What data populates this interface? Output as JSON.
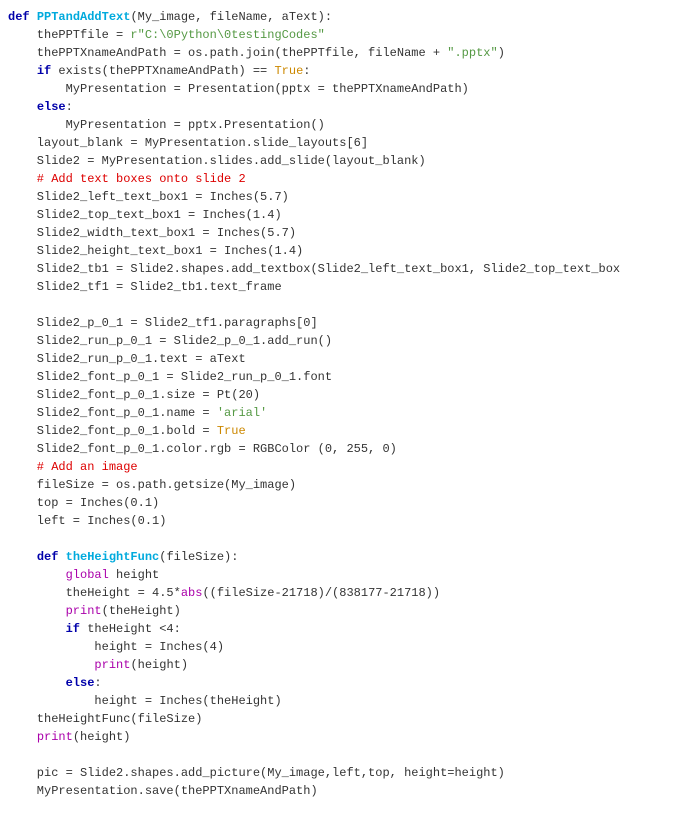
{
  "code": {
    "line": "def ",
    "defName": "PPTandAddText",
    "params": "(My_image, fileName, aText):",
    "l2a": "    thePPTfile = ",
    "l2b": "r\"C:\\0Python\\0testingCodes\"",
    "l3a": "    thePPTXnameAndPath = os.path.join(thePPTfile, fileName + ",
    "l3b": "\".pptx\"",
    "l3c": ")",
    "l4a": "    ",
    "l4if": "if",
    "l4b": " exists(thePPTXnameAndPath) == ",
    "l4true": "True",
    "l4c": ":",
    "l5": "        MyPresentation = Presentation(pptx = thePPTXnameAndPath)",
    "l6a": "    ",
    "l6else": "else",
    "l6b": ":",
    "l7": "        MyPresentation = pptx.Presentation()",
    "l8": "    layout_blank = MyPresentation.slide_layouts[6]",
    "l9": "    Slide2 = MyPresentation.slides.add_slide(layout_blank)",
    "l10": "    # Add text boxes onto slide 2",
    "l11": "    Slide2_left_text_box1 = Inches(5.7)",
    "l12": "    Slide2_top_text_box1 = Inches(1.4)",
    "l13": "    Slide2_width_text_box1 = Inches(5.7)",
    "l14": "    Slide2_height_text_box1 = Inches(1.4)",
    "l15": "    Slide2_tb1 = Slide2.shapes.add_textbox(Slide2_left_text_box1, Slide2_top_text_box",
    "l16": "    Slide2_tf1 = Slide2_tb1.text_frame",
    "l17": "",
    "l18": "    Slide2_p_0_1 = Slide2_tf1.paragraphs[0]",
    "l19": "    Slide2_run_p_0_1 = Slide2_p_0_1.add_run()",
    "l20": "    Slide2_run_p_0_1.text = aText",
    "l21": "    Slide2_font_p_0_1 = Slide2_run_p_0_1.font",
    "l22": "    Slide2_font_p_0_1.size = Pt(20)",
    "l23a": "    Slide2_font_p_0_1.name = ",
    "l23b": "'arial'",
    "l24a": "    Slide2_font_p_0_1.bold = ",
    "l24true": "True",
    "l25": "    Slide2_font_p_0_1.color.rgb = RGBColor (0, 255, 0)",
    "l26": "    # Add an image",
    "l27": "    fileSize = os.path.getsize(My_image)",
    "l28": "    top = Inches(0.1)",
    "l29": "    left = Inches(0.1)",
    "l30": "",
    "l31a": "    ",
    "l31def": "def",
    "l31b": " ",
    "l31fn": "theHeightFunc",
    "l31c": "(fileSize):",
    "l32a": "        ",
    "l32global": "global",
    "l32b": " height",
    "l33a": "        theHeight = 4.5*",
    "l33abs": "abs",
    "l33b": "((fileSize-21718)/(838177-21718))",
    "l34a": "        ",
    "l34print": "print",
    "l34b": "(theHeight)",
    "l35a": "        ",
    "l35if": "if",
    "l35b": " theHeight <4:",
    "l36": "            height = Inches(4)",
    "l37a": "            ",
    "l37print": "print",
    "l37b": "(height)",
    "l38a": "        ",
    "l38else": "else",
    "l38b": ":",
    "l39": "            height = Inches(theHeight)",
    "l40": "    theHeightFunc(fileSize)",
    "l41a": "    ",
    "l41print": "print",
    "l41b": "(height)",
    "l42": "",
    "l43": "    pic = Slide2.shapes.add_picture(My_image,left,top, height=height)",
    "l44": "    MyPresentation.save(thePPTXnameAndPath)"
  }
}
